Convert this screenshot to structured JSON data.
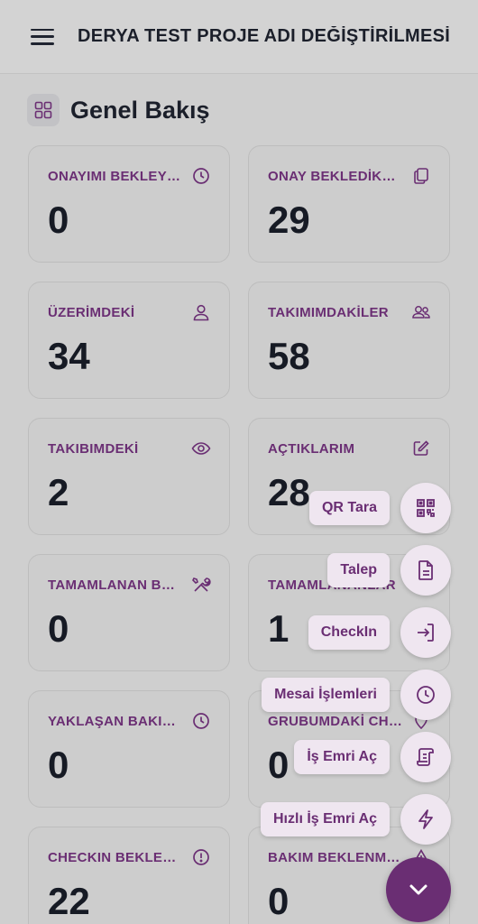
{
  "header": {
    "title": "DERYA TEST PROJE ADI DEĞİŞTİRİLMESİ"
  },
  "section": {
    "title": "Genel Bakış"
  },
  "cards": [
    {
      "label": "ONAYIMI BEKLEYENLER",
      "value": "0",
      "icon": "clock-icon"
    },
    {
      "label": "ONAY BEKLEDİKLERİM",
      "value": "29",
      "icon": "documents-icon"
    },
    {
      "label": "ÜZERİMDEKİ",
      "value": "34",
      "icon": "user-icon"
    },
    {
      "label": "TAKIMIMDAKİLER",
      "value": "58",
      "icon": "users-icon"
    },
    {
      "label": "TAKIBIMDEKİ",
      "value": "2",
      "icon": "eye-icon"
    },
    {
      "label": "AÇTIKLARIM",
      "value": "28",
      "icon": "edit-icon"
    },
    {
      "label": "TAMAMLANAN BAKIMLAR",
      "value": "0",
      "icon": "tools-icon"
    },
    {
      "label": "TAMAMLANANLAR",
      "value": "1",
      "icon": "check-icon"
    },
    {
      "label": "YAKLAŞAN BAKIMLAR",
      "value": "0",
      "icon": "clock-icon"
    },
    {
      "label": "GRUBUMDAKİ CHECKINLER",
      "value": "0",
      "icon": "location-icon"
    },
    {
      "label": "CHECKIN BEKLENENLER",
      "value": "22",
      "icon": "alert-circle-icon"
    },
    {
      "label": "BAKIM BEKLENMEDİK",
      "value": "0",
      "icon": "warning-icon"
    }
  ],
  "speed_dial": {
    "qr": "QR Tara",
    "talep": "Talep",
    "checkin": "CheckIn",
    "mesai": "Mesai İşlemleri",
    "is_emri": "İş Emri Aç",
    "hizli_is_emri": "Hızlı İş Emri Aç"
  },
  "colors": {
    "accent": "#6a2e73",
    "fab_bg": "#efe6f0",
    "text_dark": "#161a24"
  }
}
